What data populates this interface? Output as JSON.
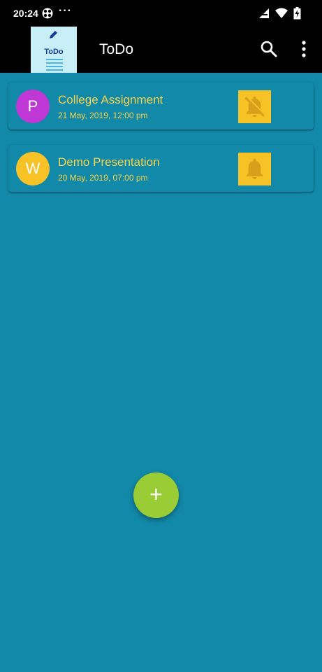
{
  "status_bar": {
    "time": "20:24",
    "more": "···",
    "icons": [
      "sync-icon",
      "signal-icon",
      "wifi-icon",
      "battery-charging-icon"
    ]
  },
  "app_bar": {
    "logo_text": "ToDo",
    "title": "ToDo",
    "actions": [
      "search-icon",
      "more-vert-icon"
    ]
  },
  "todos": [
    {
      "avatar_letter": "P",
      "avatar_color": "#bf38d6",
      "title": "College Assignment",
      "date": "21 May, 2019, 12:00 pm",
      "alarm_icon": "bell-off-icon"
    },
    {
      "avatar_letter": "W",
      "avatar_color": "#f6c226",
      "title": "Demo Presentation",
      "date": "20 May, 2019, 07:00 pm",
      "alarm_icon": "bell-icon"
    }
  ],
  "fab": {
    "label": "+",
    "icon": "add-icon",
    "color": "#9acc35"
  },
  "colors": {
    "background": "#1289a8",
    "accent_text": "#f5d24a",
    "bell_tile": "#f6c226"
  }
}
